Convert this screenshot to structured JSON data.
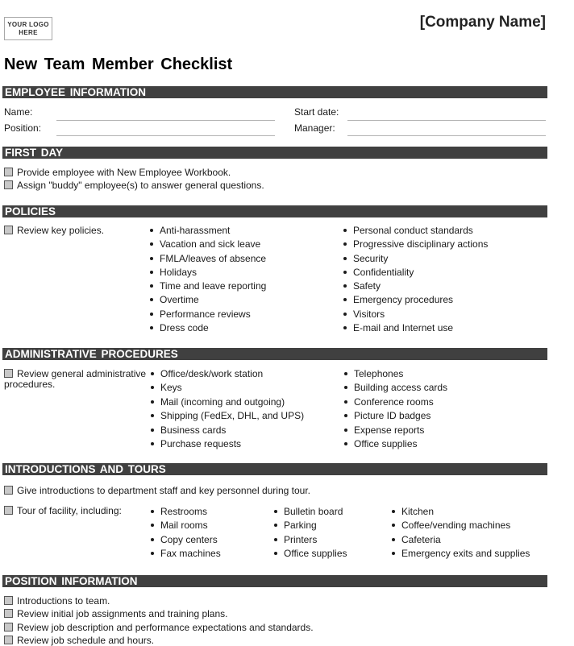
{
  "header": {
    "logo_text": "YOUR LOGO HERE",
    "company_name": "[Company Name]",
    "title": "New Team Member Checklist"
  },
  "employee_info": {
    "heading": "EMPLOYEE INFORMATION",
    "fields": {
      "name_label": "Name:",
      "name_value": "",
      "position_label": "Position:",
      "position_value": "",
      "start_date_label": "Start date:",
      "start_date_value": "",
      "manager_label": "Manager:",
      "manager_value": ""
    }
  },
  "first_day": {
    "heading": "FIRST DAY",
    "items": [
      {
        "label": "Provide employee with New Employee Workbook.",
        "checked": false
      },
      {
        "label": "Assign \"buddy\" employee(s) to answer general questions.",
        "checked": false
      }
    ]
  },
  "policies": {
    "heading": "POLICIES",
    "task": {
      "label": "Review key policies.",
      "checked": false
    },
    "col1": [
      "Anti-harassment",
      "Vacation and sick leave",
      "FMLA/leaves of absence",
      "Holidays",
      "Time and leave reporting",
      "Overtime",
      "Performance reviews",
      "Dress code"
    ],
    "col2": [
      "Personal conduct standards",
      "Progressive disciplinary actions",
      "Security",
      "Confidentiality",
      "Safety",
      "Emergency procedures",
      "Visitors",
      "E-mail and Internet use"
    ]
  },
  "admin": {
    "heading": "ADMINISTRATIVE PROCEDURES",
    "task": {
      "label_line1": "Review general administrative",
      "label_line2": "procedures.",
      "checked": false
    },
    "col1": [
      "Office/desk/work station",
      "Keys",
      "Mail (incoming and outgoing)",
      "Shipping (FedEx, DHL, and UPS)",
      "Business cards",
      "Purchase requests"
    ],
    "col2": [
      "Telephones",
      "Building access cards",
      "Conference rooms",
      "Picture ID badges",
      "Expense reports",
      "Office supplies"
    ]
  },
  "intros": {
    "heading": "INTRODUCTIONS AND TOURS",
    "task1": {
      "label": "Give introductions to department staff and key personnel during tour.",
      "checked": false
    },
    "task2": {
      "label": "Tour of facility, including:",
      "checked": false
    },
    "col1": [
      "Restrooms",
      "Mail rooms",
      "Copy centers",
      "Fax machines"
    ],
    "col2": [
      "Bulletin board",
      "Parking",
      "Printers",
      "Office supplies"
    ],
    "col3": [
      "Kitchen",
      "Coffee/vending machines",
      "Cafeteria",
      "Emergency exits and supplies"
    ]
  },
  "position_info": {
    "heading": "POSITION INFORMATION",
    "items": [
      {
        "label": "Introductions to team.",
        "checked": false
      },
      {
        "label": "Review initial job assignments and training plans.",
        "checked": false
      },
      {
        "label": "Review job description and performance expectations and standards.",
        "checked": false
      },
      {
        "label": "Review job schedule and hours.",
        "checked": false
      }
    ]
  }
}
